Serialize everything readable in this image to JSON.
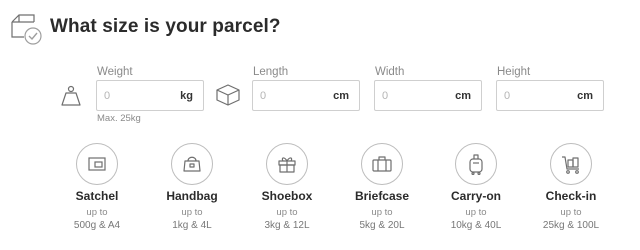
{
  "header": {
    "title": "What size is your parcel?",
    "icon": "box-check-icon"
  },
  "fields": {
    "weight": {
      "label": "Weight",
      "placeholder": "0",
      "unit": "kg",
      "hint": "Max. 25kg",
      "icon": "weight-icon"
    },
    "length": {
      "label": "Length",
      "placeholder": "0",
      "unit": "cm",
      "icon": "box-icon"
    },
    "width": {
      "label": "Width",
      "placeholder": "0",
      "unit": "cm"
    },
    "height": {
      "label": "Height",
      "placeholder": "0",
      "unit": "cm"
    }
  },
  "sizes": [
    {
      "name": "Satchel",
      "upto": "up to",
      "limit": "500g & A4",
      "icon": "satchel-icon"
    },
    {
      "name": "Handbag",
      "upto": "up to",
      "limit": "1kg & 4L",
      "icon": "handbag-icon"
    },
    {
      "name": "Shoebox",
      "upto": "up to",
      "limit": "3kg & 12L",
      "icon": "gift-box-icon"
    },
    {
      "name": "Briefcase",
      "upto": "up to",
      "limit": "5kg & 20L",
      "icon": "briefcase-icon"
    },
    {
      "name": "Carry-on",
      "upto": "up to",
      "limit": "10kg & 40L",
      "icon": "carry-on-icon"
    },
    {
      "name": "Check-in",
      "upto": "up to",
      "limit": "25kg & 100L",
      "icon": "trolley-icon"
    }
  ],
  "colors": {
    "icon_stroke": "#6f6f6f",
    "border": "#cfcfcf",
    "accent_check": "#9e9e9e"
  }
}
